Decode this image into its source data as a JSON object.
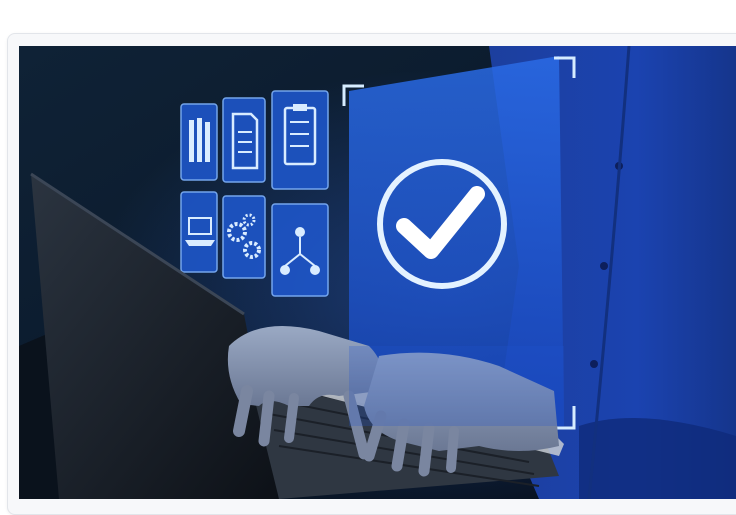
{
  "card": {
    "image": {
      "subject": "hands-typing-on-laptop-with-holographic-icons",
      "icons": [
        "books-icon",
        "document-icon",
        "checklist-icon",
        "laptop-icon",
        "gears-icon",
        "network-icon",
        "checkmark-icon"
      ]
    }
  },
  "colors": {
    "background": "#ffffff",
    "card_border": "#e2e5ea",
    "hologram": "#1f5fd6",
    "hologram_line": "#cfe6ff",
    "shirt": "#1a3fa8",
    "night": "#0a1626"
  }
}
